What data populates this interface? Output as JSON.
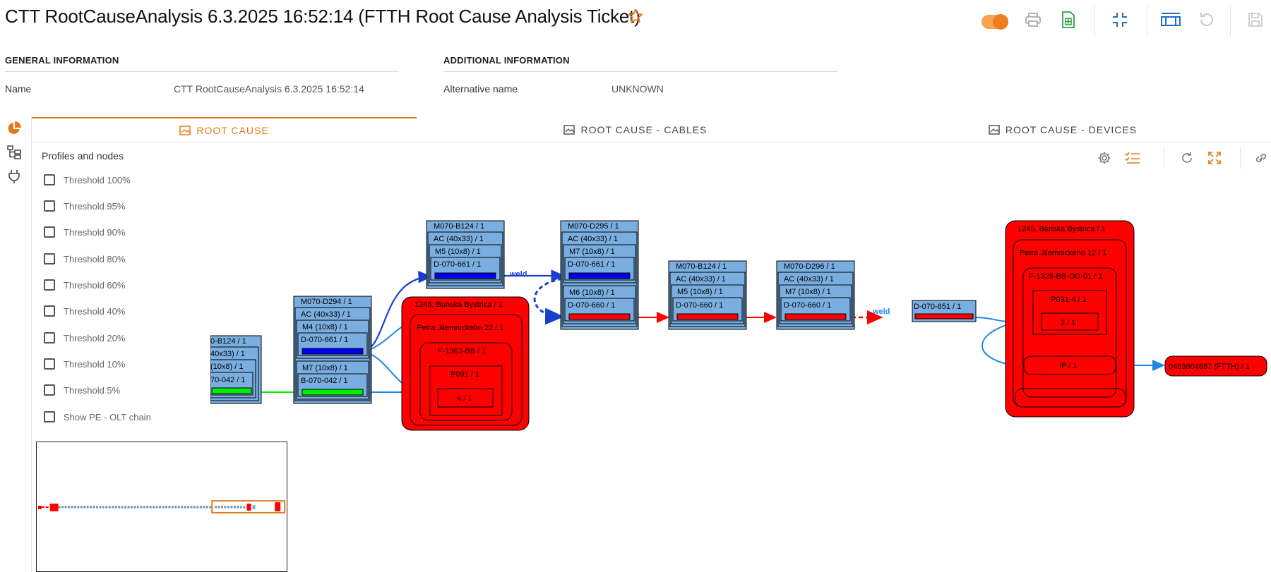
{
  "header": {
    "title": "CTT RootCauseAnalysis 6.3.2025 16:52:14 (FTTH Root Cause Analysis Ticket)"
  },
  "general": {
    "heading": "GENERAL INFORMATION",
    "name_label": "Name",
    "name_value": "CTT RootCauseAnalysis 6.3.2025 16:52:14"
  },
  "additional": {
    "heading": "ADDITIONAL INFORMATION",
    "alt_label": "Alternative name",
    "alt_value": "UNKNOWN"
  },
  "tabs": [
    {
      "label": "ROOT CAUSE",
      "active": true
    },
    {
      "label": "ROOT CAUSE - CABLES",
      "active": false
    },
    {
      "label": "ROOT CAUSE - DEVICES",
      "active": false
    }
  ],
  "filters": {
    "title": "Profiles and nodes",
    "items": [
      "Threshold 100%",
      "Threshold 95%",
      "Threshold 90%",
      "Threshold 80%",
      "Threshold 60%",
      "Threshold 40%",
      "Threshold 20%",
      "Threshold 10%",
      "Threshold 5%",
      "Show PE - OLT chain"
    ]
  },
  "colors": {
    "accent": "#e07a1b",
    "node_fill": "#7aaee0",
    "device_red": "#ff0000",
    "path_blue": "#1e88e5",
    "fiber_green": "#00ee00"
  },
  "graph": {
    "n1": [
      "0-B124 / 1",
      "40x33) / 1",
      "(10x8) / 1",
      "70-042 / 1"
    ],
    "n2": [
      "M070-D294 / 1",
      "AC (40x33) / 1",
      "M4 (10x8) / 1",
      "D-070-661 / 1",
      "M7 (10x8) / 1",
      "B-070-042 / 1"
    ],
    "n3": [
      "M070-B124 / 1",
      "AC (40x33) / 1",
      "M5 (10x8) / 1",
      "D-070-661 / 1"
    ],
    "n4": [
      "M070-D295 / 1",
      "AC (40x33) / 1",
      "M7 (10x8) / 1",
      "D-070-661 / 1",
      "M6 (10x8) / 1",
      "D-070-660 / 1"
    ],
    "n5": [
      "M070-B124 / 1",
      "AC (40x33) / 1",
      "M5 (10x8) / 1",
      "D-070-660 / 1"
    ],
    "n6": [
      "M070-D296 / 1",
      "AC (40x33) / 1",
      "M7 (10x8) / 1",
      "D-070-660 / 1"
    ],
    "n7": "D-070-651 / 1",
    "r1": [
      "1248, Banská Bystrica / 1",
      "Petra Jilemnického 22 / 1",
      "F-1363-BB / 1",
      "P091 / 1",
      "4 / 1"
    ],
    "r2": [
      "1245, Banská Bystrica / 1",
      "Petra Jilemnického 12 / 1",
      "F-1328-BB-OD-01 / 1",
      "P091-4 / 1",
      "2 / 1",
      "IP / 1"
    ],
    "end": "0483904887 (FTTH) / 1",
    "weld1": "weld",
    "weld2": "weld"
  }
}
